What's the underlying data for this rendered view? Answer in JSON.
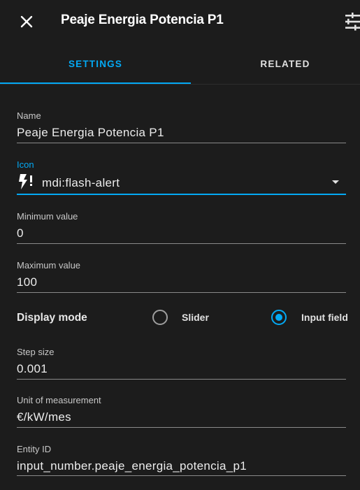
{
  "dialog": {
    "title": "Peaje Energia Potencia P1",
    "close_icon": "close-icon",
    "settings_icon": "tune-icon"
  },
  "tabs": [
    {
      "label": "SETTINGS",
      "active": true
    },
    {
      "label": "RELATED",
      "active": false
    }
  ],
  "fields": {
    "name": {
      "label": "Name",
      "value": "Peaje Energia Potencia P1"
    },
    "icon": {
      "label": "Icon",
      "value": "mdi:flash-alert",
      "icon_name": "flash-alert-icon"
    },
    "min": {
      "label": "Minimum value",
      "value": "0"
    },
    "max": {
      "label": "Maximum value",
      "value": "100"
    },
    "step": {
      "label": "Step size",
      "value": "0.001"
    },
    "unit": {
      "label": "Unit of measurement",
      "value": "€/kW/mes"
    },
    "entity_id": {
      "label": "Entity ID",
      "value": "input_number.peaje_energia_potencia_p1"
    }
  },
  "display_mode": {
    "label": "Display mode",
    "options": [
      {
        "label": "Slider",
        "selected": false
      },
      {
        "label": "Input field",
        "selected": true
      }
    ]
  },
  "colors": {
    "accent": "#03a9f4",
    "background": "#1c1c1c",
    "text": "#e1e1e1"
  }
}
